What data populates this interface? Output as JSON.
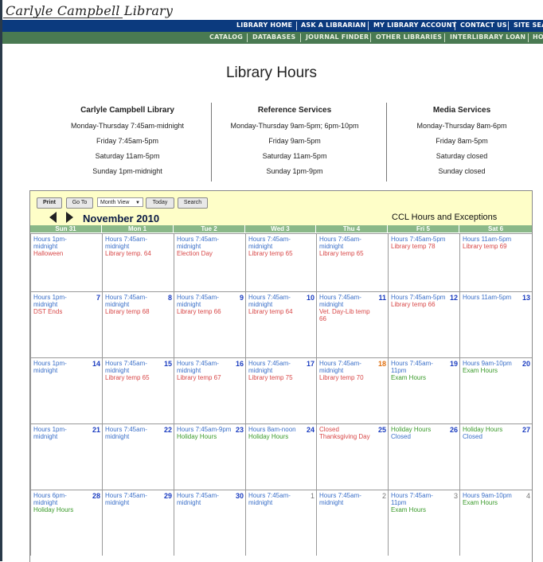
{
  "site": {
    "logo": "Carlyle Campbell Library"
  },
  "nav_primary": [
    "LIBRARY HOME",
    "ASK A LIBRARIAN",
    "MY LIBRARY ACCOUNT",
    "CONTACT US",
    "SITE SEA"
  ],
  "nav_secondary": [
    "CATALOG",
    "DATABASES",
    "JOURNAL FINDER",
    "OTHER LIBRARIES",
    "INTERLIBRARY LOAN",
    "HO"
  ],
  "page": {
    "title": "Library Hours"
  },
  "hours_columns": [
    {
      "heading": "Carlyle Campbell Library",
      "lines": [
        "Monday-Thursday 7:45am-midnight",
        "Friday 7:45am-5pm",
        "Saturday 11am-5pm",
        "Sunday 1pm-midnight"
      ]
    },
    {
      "heading": "Reference Services",
      "lines": [
        "Monday-Thursday 9am-5pm; 6pm-10pm",
        "Friday 9am-5pm",
        "Saturday 11am-5pm",
        "Sunday 1pm-9pm"
      ]
    },
    {
      "heading": "Media Services",
      "lines": [
        "Monday-Thursday 8am-6pm",
        "Friday 8am-5pm",
        "Saturday closed",
        "Sunday closed"
      ]
    }
  ],
  "calendar": {
    "buttons": {
      "print": "Print",
      "goto": "Go To",
      "view": "Month View",
      "today": "Today",
      "search": "Search"
    },
    "month_label": "November 2010",
    "calendar_title": "CCL Hours and Exceptions",
    "dow_headers": [
      "Sun 31",
      "Mon 1",
      "Tue 2",
      "Wed 3",
      "Thu 4",
      "Fri 5",
      "Sat 6"
    ],
    "weeks": [
      [
        {
          "day": "",
          "events": [
            [
              "Hours 1pm-midnight",
              "blue"
            ],
            [
              "Halloween",
              "red"
            ]
          ]
        },
        {
          "day": "",
          "events": [
            [
              "Hours 7:45am-midnight",
              "blue"
            ],
            [
              "Library temp. 64",
              "red"
            ]
          ]
        },
        {
          "day": "",
          "events": [
            [
              "Hours 7:45am-midnight",
              "blue"
            ],
            [
              "Election Day",
              "red"
            ]
          ]
        },
        {
          "day": "",
          "events": [
            [
              "Hours 7:45am-midnight",
              "blue"
            ],
            [
              "Library temp 65",
              "red"
            ]
          ]
        },
        {
          "day": "",
          "events": [
            [
              "Hours 7:45am-midnight",
              "blue"
            ],
            [
              "Library temp 65",
              "red"
            ]
          ]
        },
        {
          "day": "",
          "events": [
            [
              "Hours 7:45am-5pm",
              "blue"
            ],
            [
              "Library temp 78",
              "red"
            ]
          ]
        },
        {
          "day": "",
          "events": [
            [
              "Hours 11am-5pm",
              "blue"
            ],
            [
              "Library temp 69",
              "red"
            ]
          ]
        }
      ],
      [
        {
          "day": "7",
          "events": [
            [
              "Hours 1pm-midnight",
              "blue"
            ],
            [
              "DST Ends",
              "red"
            ]
          ]
        },
        {
          "day": "8",
          "events": [
            [
              "Hours 7:45am-midnight",
              "blue"
            ],
            [
              "Library temp 68",
              "red"
            ]
          ]
        },
        {
          "day": "9",
          "events": [
            [
              "Hours 7:45am-midnight",
              "blue"
            ],
            [
              "Library temp 66",
              "red"
            ]
          ]
        },
        {
          "day": "10",
          "events": [
            [
              "Hours 7:45am-midnight",
              "blue"
            ],
            [
              "Library temp 64",
              "red"
            ]
          ]
        },
        {
          "day": "11",
          "events": [
            [
              "Hours 7:45am-midnight",
              "blue"
            ],
            [
              "Vet. Day-Lib temp 66",
              "red"
            ]
          ]
        },
        {
          "day": "12",
          "events": [
            [
              "Hours 7:45am-5pm",
              "blue"
            ],
            [
              "Library temp 66",
              "red"
            ]
          ]
        },
        {
          "day": "13",
          "events": [
            [
              "Hours 11am-5pm",
              "blue"
            ]
          ]
        }
      ],
      [
        {
          "day": "14",
          "events": [
            [
              "Hours 1pm-midnight",
              "blue"
            ]
          ]
        },
        {
          "day": "15",
          "events": [
            [
              "Hours 7:45am-midnight",
              "blue"
            ],
            [
              "Library temp 65",
              "red"
            ]
          ]
        },
        {
          "day": "16",
          "events": [
            [
              "Hours 7:45am-midnight",
              "blue"
            ],
            [
              "Library temp 67",
              "red"
            ]
          ]
        },
        {
          "day": "17",
          "events": [
            [
              "Hours 7:45am-midnight",
              "blue"
            ],
            [
              "Library temp 75",
              "red"
            ]
          ]
        },
        {
          "day": "18",
          "events": [
            [
              "Hours 7:45am-midnight",
              "blue"
            ],
            [
              "Library temp 70",
              "red"
            ]
          ],
          "today": true
        },
        {
          "day": "19",
          "events": [
            [
              "Hours 7:45am-11pm",
              "blue"
            ],
            [
              "Exam Hours",
              "green"
            ]
          ]
        },
        {
          "day": "20",
          "events": [
            [
              "Hours 9am-10pm",
              "blue"
            ],
            [
              "Exam Hours",
              "green"
            ]
          ]
        }
      ],
      [
        {
          "day": "21",
          "events": [
            [
              "Hours 1pm-midnight",
              "blue"
            ]
          ]
        },
        {
          "day": "22",
          "events": [
            [
              "Hours 7:45am-midnight",
              "blue"
            ]
          ]
        },
        {
          "day": "23",
          "events": [
            [
              "Hours 7:45am-9pm",
              "blue"
            ],
            [
              "Holiday Hours",
              "green"
            ]
          ]
        },
        {
          "day": "24",
          "events": [
            [
              "Hours 8am-noon",
              "blue"
            ],
            [
              "Holiday Hours",
              "green"
            ]
          ]
        },
        {
          "day": "25",
          "events": [
            [
              "Closed",
              "red"
            ],
            [
              "Thanksgiving Day",
              "red"
            ]
          ]
        },
        {
          "day": "26",
          "events": [
            [
              "Holiday Hours",
              "green"
            ],
            [
              "Closed",
              "blue"
            ]
          ]
        },
        {
          "day": "27",
          "events": [
            [
              "Holiday Hours",
              "green"
            ],
            [
              "Closed",
              "blue"
            ]
          ]
        }
      ],
      [
        {
          "day": "28",
          "events": [
            [
              "Hours 6pm-midnight",
              "blue"
            ],
            [
              "Holiday Hours",
              "green"
            ]
          ]
        },
        {
          "day": "29",
          "events": [
            [
              "Hours 7:45am-midnight",
              "blue"
            ]
          ]
        },
        {
          "day": "30",
          "events": [
            [
              "Hours 7:45am-midnight",
              "blue"
            ]
          ]
        },
        {
          "day": "1",
          "other": true,
          "events": [
            [
              "Hours 7:45am-midnight",
              "blue"
            ]
          ]
        },
        {
          "day": "2",
          "other": true,
          "events": [
            [
              "Hours 7:45am-midnight",
              "blue"
            ]
          ]
        },
        {
          "day": "3",
          "other": true,
          "events": [
            [
              "Hours 7:45am-11pm",
              "blue"
            ],
            [
              "Exam Hours",
              "green"
            ]
          ]
        },
        {
          "day": "4",
          "other": true,
          "events": [
            [
              "Hours 9am-10pm",
              "blue"
            ],
            [
              "Exam Hours",
              "green"
            ]
          ]
        }
      ]
    ]
  }
}
